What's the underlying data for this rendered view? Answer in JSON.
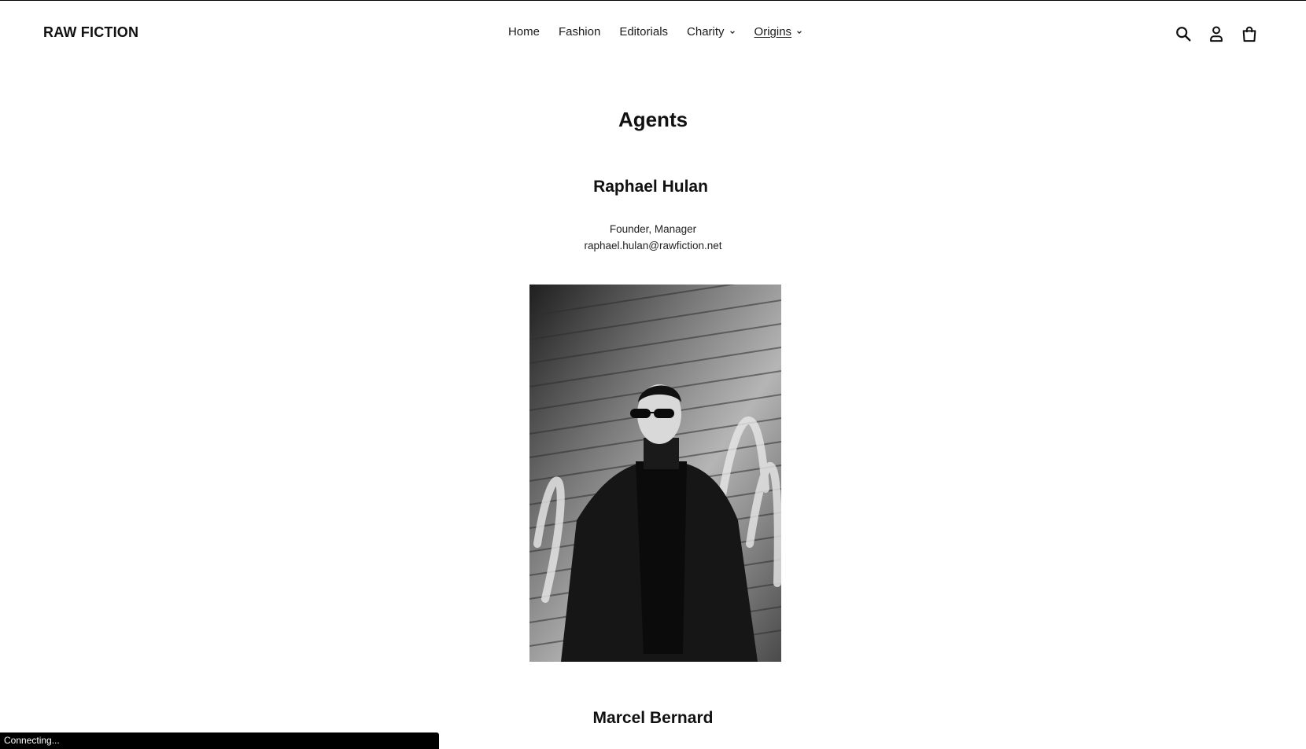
{
  "brand": {
    "logo": "RAW FICTION"
  },
  "nav": {
    "items": [
      {
        "label": "Home",
        "dropdown": false,
        "active": false
      },
      {
        "label": "Fashion",
        "dropdown": false,
        "active": false
      },
      {
        "label": "Editorials",
        "dropdown": false,
        "active": false
      },
      {
        "label": "Charity",
        "dropdown": true,
        "active": false
      },
      {
        "label": "Origins",
        "dropdown": true,
        "active": true
      }
    ]
  },
  "header_icons": [
    "search-icon",
    "account-icon",
    "cart-icon"
  ],
  "page": {
    "title": "Agents",
    "agents": [
      {
        "name": "Raphael Hulan",
        "role": "Founder, Manager",
        "email": "raphael.hulan@rawfiction.net"
      },
      {
        "name": "Marcel Bernard"
      }
    ]
  },
  "status": {
    "text": "Connecting..."
  }
}
